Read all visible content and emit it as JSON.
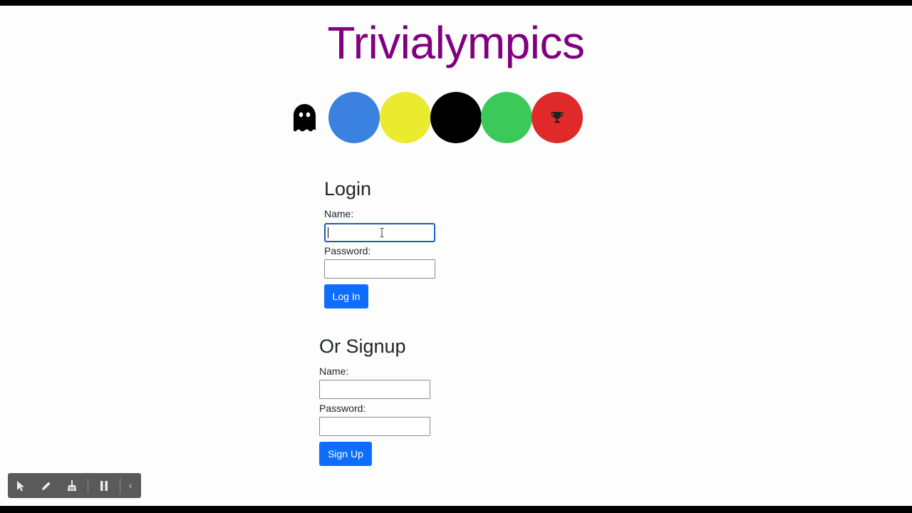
{
  "header": {
    "title": "Trivialympics"
  },
  "colors": {
    "title": "#800080",
    "ring_blue": "#3b82e0",
    "ring_yellow": "#eaea2e",
    "ring_black": "#000000",
    "ring_green": "#3bc95a",
    "ring_red": "#e02a2a",
    "primary_button": "#0d6efd"
  },
  "icons": {
    "ghost": "ghost-icon",
    "trophy": "trophy-icon"
  },
  "login": {
    "heading": "Login",
    "name_label": "Name:",
    "name_value": "",
    "password_label": "Password:",
    "password_value": "",
    "submit_label": "Log In"
  },
  "signup": {
    "heading": "Or Signup",
    "name_label": "Name:",
    "name_value": "",
    "password_label": "Password:",
    "password_value": "",
    "submit_label": "Sign Up"
  },
  "toolbar": {
    "items": [
      "pointer-icon",
      "pen-icon",
      "broom-icon",
      "pause-icon",
      "collapse-icon"
    ],
    "collapse_glyph": "‹"
  }
}
